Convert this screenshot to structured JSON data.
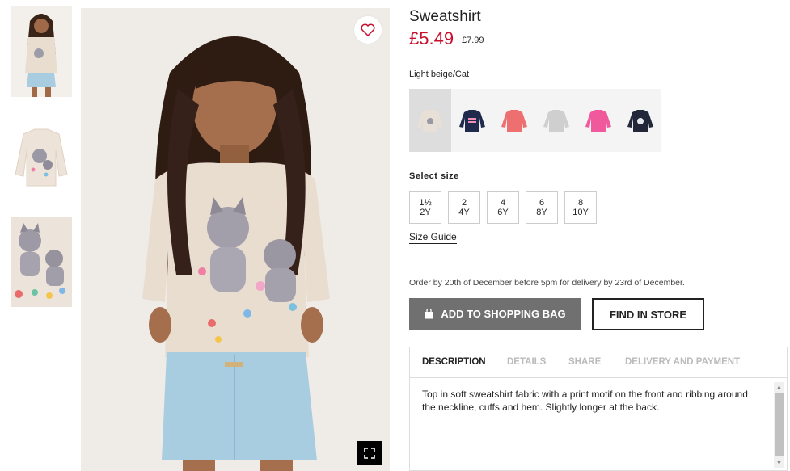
{
  "product": {
    "title": "Sweatshirt",
    "price": "£5.49",
    "old_price": "£7.99",
    "color_name": "Light beige/Cat"
  },
  "swatches": [
    {
      "name": "light-beige-cat",
      "color": "#e8e0d6",
      "selected": true
    },
    {
      "name": "navy-happy-cat",
      "color": "#1f2a4d",
      "selected": false
    },
    {
      "name": "coral",
      "color": "#ee6f6f",
      "selected": false
    },
    {
      "name": "grey-marl",
      "color": "#cfcfcf",
      "selected": false
    },
    {
      "name": "pink",
      "color": "#f05a9c",
      "selected": false
    },
    {
      "name": "dark-navy-print",
      "color": "#23273a",
      "selected": false
    }
  ],
  "sizes_label": "Select size",
  "sizes": [
    {
      "top": "1½",
      "bottom": "2Y"
    },
    {
      "top": "2",
      "bottom": "4Y"
    },
    {
      "top": "4",
      "bottom": "6Y"
    },
    {
      "top": "6",
      "bottom": "8Y"
    },
    {
      "top": "8",
      "bottom": "10Y"
    }
  ],
  "size_guide": "Size Guide",
  "order_note": "Order by 20th of December before 5pm for delivery by 23rd of December.",
  "buttons": {
    "add_to_bag": "ADD TO SHOPPING BAG",
    "find_in_store": "FIND IN STORE"
  },
  "tabs": [
    {
      "label": "DESCRIPTION",
      "active": true
    },
    {
      "label": "DETAILS",
      "active": false
    },
    {
      "label": "SHARE",
      "active": false
    },
    {
      "label": "DELIVERY AND PAYMENT",
      "active": false
    }
  ],
  "description": "Top in soft sweatshirt fabric with a print motif on the front and ribbing around the neckline, cuffs and hem. Slightly longer at the back.",
  "colors": {
    "price_red": "#c8102e",
    "button_grey": "#707070",
    "sweatshirt_beige": "#e9ddd0",
    "denim_blue": "#a9cde0"
  }
}
